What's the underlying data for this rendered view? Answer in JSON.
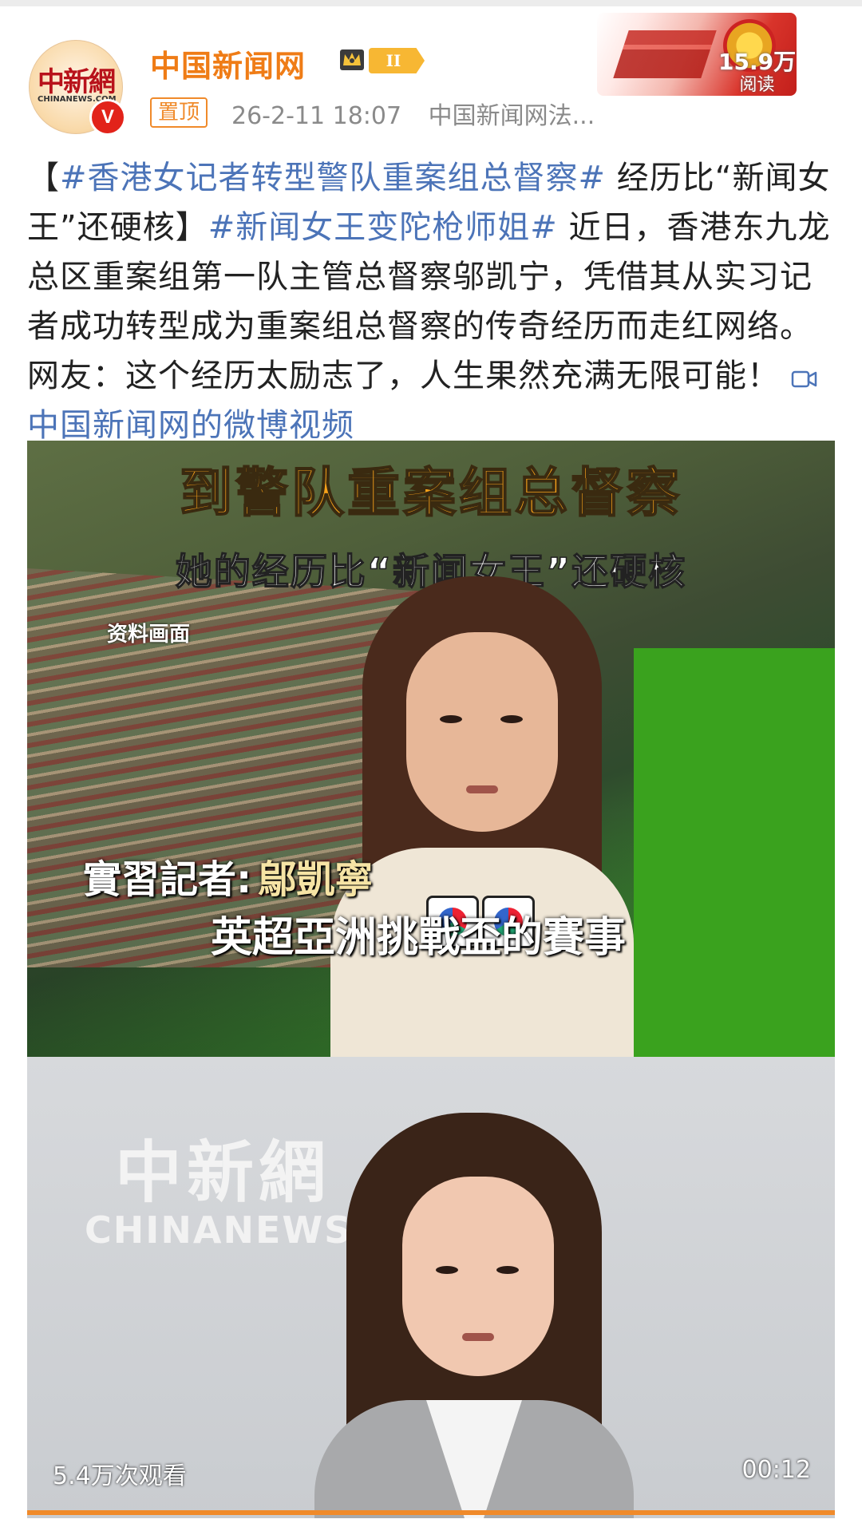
{
  "header": {
    "avatar_logo_cn": "中新網",
    "avatar_logo_en": "CHINANEWS.COM",
    "verified_badge": "V",
    "username": "中国新闻网",
    "level": "II",
    "pinned": "置顶",
    "timestamp": "26-2-11 18:07",
    "source": "中国新闻网法..."
  },
  "banner": {
    "views_count": "15.9万",
    "views_label": "阅读"
  },
  "post": {
    "bracket_open": "【",
    "hashtag1": "#香港女记者转型警队重案组总督察#",
    "title_rest": " 经历比“新闻女王”还硬核",
    "bracket_close": "】",
    "hashtag2": "#新闻女王变陀枪师姐#",
    "body": " 近日，香港东九龙总区重案组第一队主管总督察邬凯宁，凭借其从实习记者成功转型成为重案组总督察的传奇经历而走红网络。网友：这个经历太励志了，人生果然充满无限可能！",
    "video_link": "中国新闻网的微博视频"
  },
  "video": {
    "caption_top": "到警队重案组总督察",
    "caption_sub": "她的经历比“新闻女王”还硬核",
    "archive_label": "资料画面",
    "name_prefix": "實習記者:",
    "name": "鄔凱寧",
    "event": "英超亞洲挑戰盃的賽事",
    "watermark_cn": "中新網",
    "watermark_en": "CHINANEWS",
    "play_count": "5.4万次观看",
    "duration": "00:12",
    "progress": 1.0
  },
  "colors": {
    "username": "#ef7c16",
    "link": "#4c74b8",
    "pinned": "#f08a2a",
    "verified": "#e2231a"
  }
}
